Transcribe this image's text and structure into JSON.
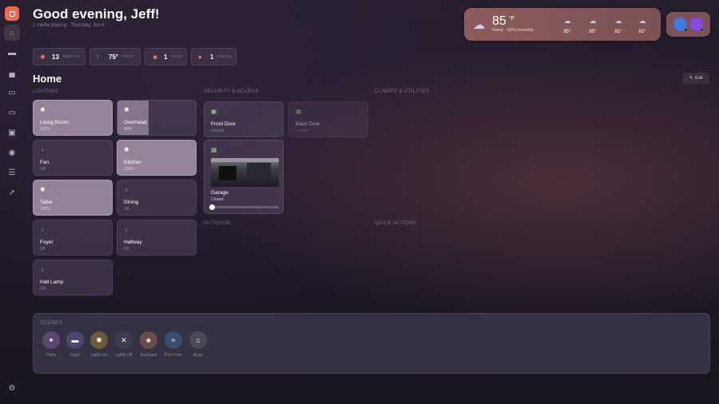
{
  "sidebar": {
    "items": [
      {
        "name": "home",
        "glyph": "⌂"
      },
      {
        "name": "bed",
        "glyph": "▬"
      },
      {
        "name": "car",
        "glyph": "▄"
      },
      {
        "name": "media",
        "glyph": "▭"
      },
      {
        "name": "laptop",
        "glyph": "▭"
      },
      {
        "name": "devices",
        "glyph": "▣"
      },
      {
        "name": "camera",
        "glyph": "◉"
      },
      {
        "name": "server",
        "glyph": "☰"
      },
      {
        "name": "rocket",
        "glyph": "➚"
      }
    ],
    "settings_glyph": "⚙"
  },
  "header": {
    "greeting": "Good evening, Jeff!",
    "subtitle": "1 media playing · Thursday, Jun 4"
  },
  "weather": {
    "temp": "85",
    "unit": "°F",
    "condition": "Rainy · 52% humidity",
    "forecast": [
      {
        "icon": "rain-cloud",
        "glyph": "☁",
        "temp": "85°"
      },
      {
        "icon": "cloud",
        "glyph": "☁",
        "temp": "85°"
      },
      {
        "icon": "rain-cloud",
        "glyph": "☁",
        "temp": "81°"
      },
      {
        "icon": "rain-cloud",
        "glyph": "☁",
        "temp": "82°"
      }
    ]
  },
  "stats": [
    {
      "icon": "light-icon",
      "glyph": "✺",
      "value": "13",
      "label": "lights on"
    },
    {
      "icon": "thermometer-icon",
      "glyph": "🌡",
      "value": "75°",
      "label": "inside"
    },
    {
      "icon": "people-icon",
      "glyph": "☻",
      "value": "1",
      "label": "home"
    },
    {
      "icon": "alert-icon",
      "glyph": "●",
      "value": "1",
      "label": "playing"
    }
  ],
  "main": {
    "title": "Home",
    "edit_label": "Edit",
    "sections": {
      "lighting": "LIGHTING",
      "security": "SECURITY & ACCESS",
      "climate": "CLIMATE & UTILITIES",
      "outdoor": "OUTDOOR",
      "quick_actions": "QUICK ACTIONS"
    }
  },
  "lights": [
    {
      "name": "Living Room",
      "state": "100%",
      "level": 1.0
    },
    {
      "name": "Overhead",
      "state": "40%",
      "level": 0.4
    },
    {
      "name": "Fan",
      "state": "Off",
      "level": 0
    },
    {
      "name": "Kitchen",
      "state": "100%",
      "level": 1.0
    },
    {
      "name": "Table",
      "state": "100%",
      "level": 1.0
    },
    {
      "name": "Dining",
      "state": "Off",
      "level": 0
    },
    {
      "name": "Foyer",
      "state": "Off",
      "level": 0
    },
    {
      "name": "Hallway",
      "state": "Off",
      "level": 0
    },
    {
      "name": "Hall Lamp",
      "state": "Off",
      "level": 0
    }
  ],
  "security": {
    "front_door": {
      "name": "Front Door",
      "state": "Locked"
    },
    "back_door": {
      "name": "Back Door",
      "state": "Locked"
    },
    "garage": {
      "name": "Garage",
      "state": "Closed",
      "open_level": 0
    }
  },
  "scenes": {
    "title": "SCENES",
    "items": [
      {
        "name": "Party",
        "glyph": "🎉",
        "color": "#5a4670"
      },
      {
        "name": "Night",
        "glyph": "▬",
        "color": "#4b4670"
      },
      {
        "name": "Lights On",
        "glyph": "✺",
        "color": "#6b5a3c"
      },
      {
        "name": "Lights Off",
        "glyph": "✕",
        "color": "#3e3c4c"
      },
      {
        "name": "Backyard",
        "glyph": "♣",
        "color": "#6a4c4a"
      },
      {
        "name": "Pool Time",
        "glyph": "≈",
        "color": "#3c4c70"
      },
      {
        "name": "Away",
        "glyph": "⌂",
        "color": "#4a4a56"
      }
    ]
  },
  "colors": {
    "accent": "#f26a4b"
  }
}
